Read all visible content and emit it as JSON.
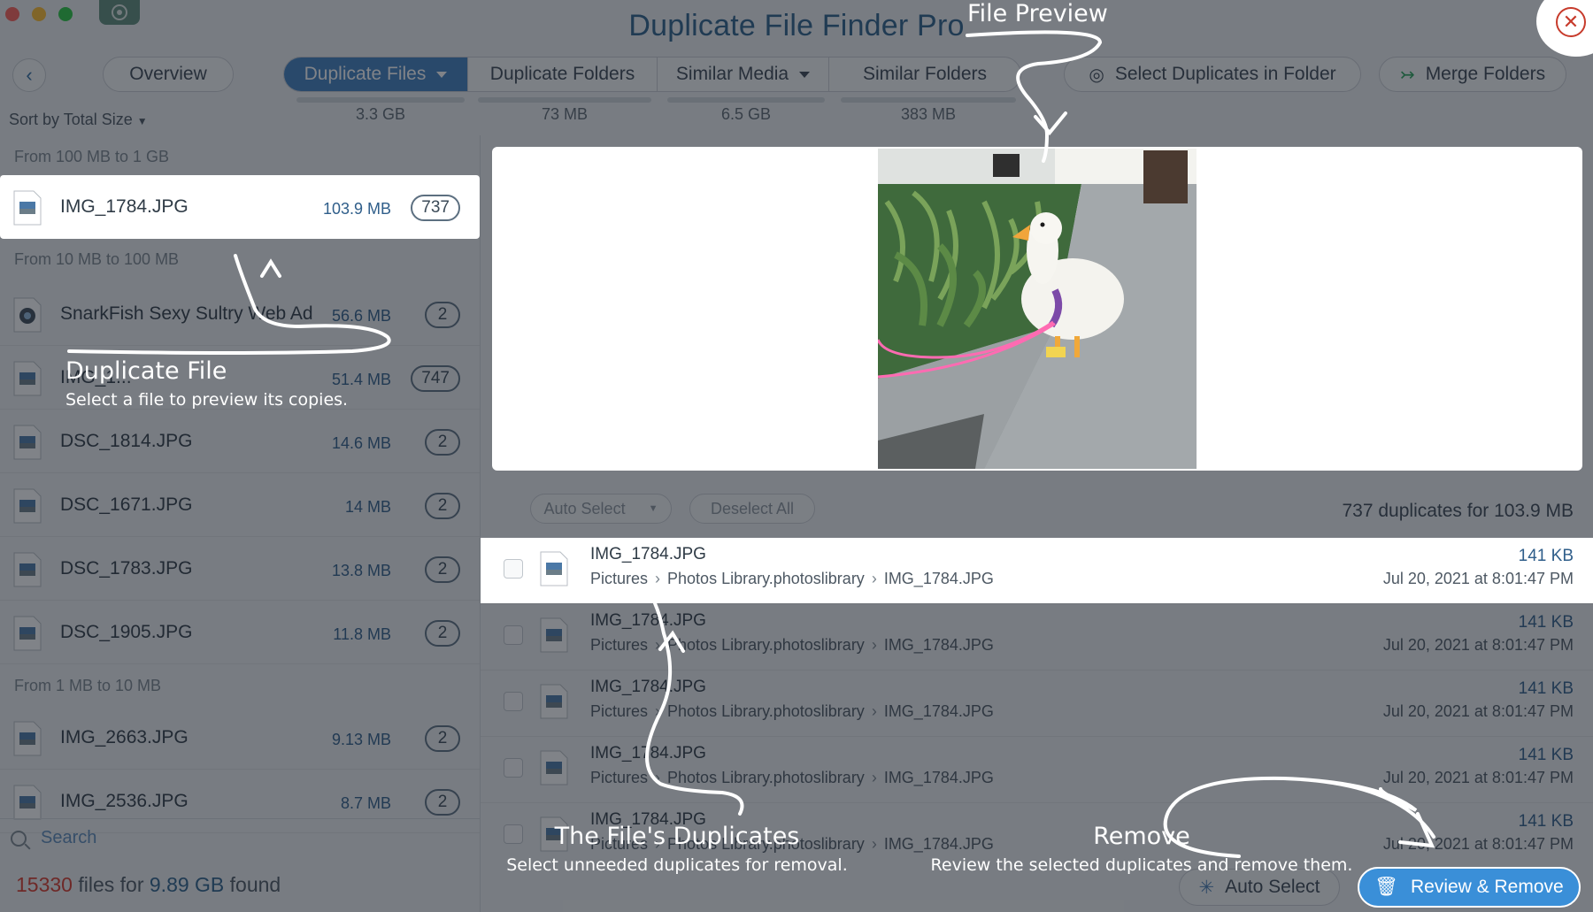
{
  "app": {
    "title": "Duplicate File Finder Pro"
  },
  "toolbar": {
    "overview": "Overview",
    "tabs": [
      {
        "label": "Duplicate Files",
        "size": "3.3 GB",
        "active": true,
        "dropdown": true
      },
      {
        "label": "Duplicate Folders",
        "size": "73 MB",
        "active": false,
        "dropdown": false
      },
      {
        "label": "Similar Media",
        "size": "6.5 GB",
        "active": false,
        "dropdown": true
      },
      {
        "label": "Similar Folders",
        "size": "383 MB",
        "active": false,
        "dropdown": false
      }
    ],
    "select_duplicates": "Select Duplicates in Folder",
    "merge_folders": "Merge Folders"
  },
  "sidebar": {
    "sort_label": "Sort by Total Size",
    "groups": [
      {
        "label": "From 100 MB to 1 GB"
      },
      {
        "label": "From 10 MB to 100 MB"
      },
      {
        "label": "From 1 MB to 10 MB"
      }
    ],
    "files": [
      {
        "name": "IMG_1784.JPG",
        "size": "103.9 MB",
        "count": "737",
        "icon": "jpeg-file-icon"
      },
      {
        "name": "SnarkFish Sexy Sultry Web Ad",
        "size": "56.6 MB",
        "count": "2",
        "icon": "video-file-icon"
      },
      {
        "name": "IMG_1...",
        "size": "51.4 MB",
        "count": "747",
        "icon": "jpeg-file-icon"
      },
      {
        "name": "DSC_1814.JPG",
        "size": "14.6 MB",
        "count": "2",
        "icon": "jpeg-file-icon"
      },
      {
        "name": "DSC_1671.JPG",
        "size": "14 MB",
        "count": "2",
        "icon": "jpeg-file-icon"
      },
      {
        "name": "DSC_1783.JPG",
        "size": "13.8 MB",
        "count": "2",
        "icon": "jpeg-file-icon"
      },
      {
        "name": "DSC_1905.JPG",
        "size": "11.8 MB",
        "count": "2",
        "icon": "jpeg-file-icon"
      },
      {
        "name": "IMG_2663.JPG",
        "size": "9.13 MB",
        "count": "2",
        "icon": "jpeg-file-icon"
      },
      {
        "name": "IMG_2536.JPG",
        "size": "8.7 MB",
        "count": "2",
        "icon": "jpeg-file-icon"
      }
    ],
    "search_placeholder": "Search"
  },
  "status": {
    "count": "15330",
    "mid": "files for",
    "size": "9.89 GB",
    "end": "found"
  },
  "duplicates": {
    "auto_select": "Auto Select",
    "deselect_all": "Deselect All",
    "summary": "737 duplicates for 103.9 MB",
    "rows": [
      {
        "name": "IMG_1784.JPG",
        "path": [
          "Pictures",
          "Photos Library.photoslibrary",
          "IMG_1784.JPG"
        ],
        "size": "141 KB",
        "date": "Jul 20, 2021 at 8:01:47 PM"
      },
      {
        "name": "IMG_1784.JPG",
        "path": [
          "Pictures",
          "Photos Library.photoslibrary",
          "IMG_1784.JPG"
        ],
        "size": "141 KB",
        "date": "Jul 20, 2021 at 8:01:47 PM"
      },
      {
        "name": "IMG_1784.JPG",
        "path": [
          "Pictures",
          "Photos Library.photoslibrary",
          "IMG_1784.JPG"
        ],
        "size": "141 KB",
        "date": "Jul 20, 2021 at 8:01:47 PM"
      },
      {
        "name": "IMG_1784.JPG",
        "path": [
          "Pictures",
          "Photos Library.photoslibrary",
          "IMG_1784.JPG"
        ],
        "size": "141 KB",
        "date": "Jul 20, 2021 at 8:01:47 PM"
      },
      {
        "name": "IMG_1784.JPG",
        "path": [
          "Pictures",
          "Photos Library.photoslibrary",
          "IMG_1784.JPG"
        ],
        "size": "141 KB",
        "date": "Jul 20, 2021 at 8:01:47 PM"
      }
    ]
  },
  "bottom": {
    "auto_select": "Auto Select",
    "review_remove": "Review & Remove"
  },
  "annotations": {
    "file_preview": "File Preview",
    "duplicate_file_title": "Duplicate File",
    "duplicate_file_sub": "Select a file to preview its copies.",
    "duplicates_title": "The File's Duplicates",
    "duplicates_sub": "Select unneeded duplicates for removal.",
    "remove_title": "Remove",
    "remove_sub": "Review the selected duplicates and remove them."
  },
  "colors": {
    "accent": "#3e7fbf",
    "title": "#2c5f8a",
    "status_red": "#d8392b",
    "review_button": "#3a8fd8"
  }
}
